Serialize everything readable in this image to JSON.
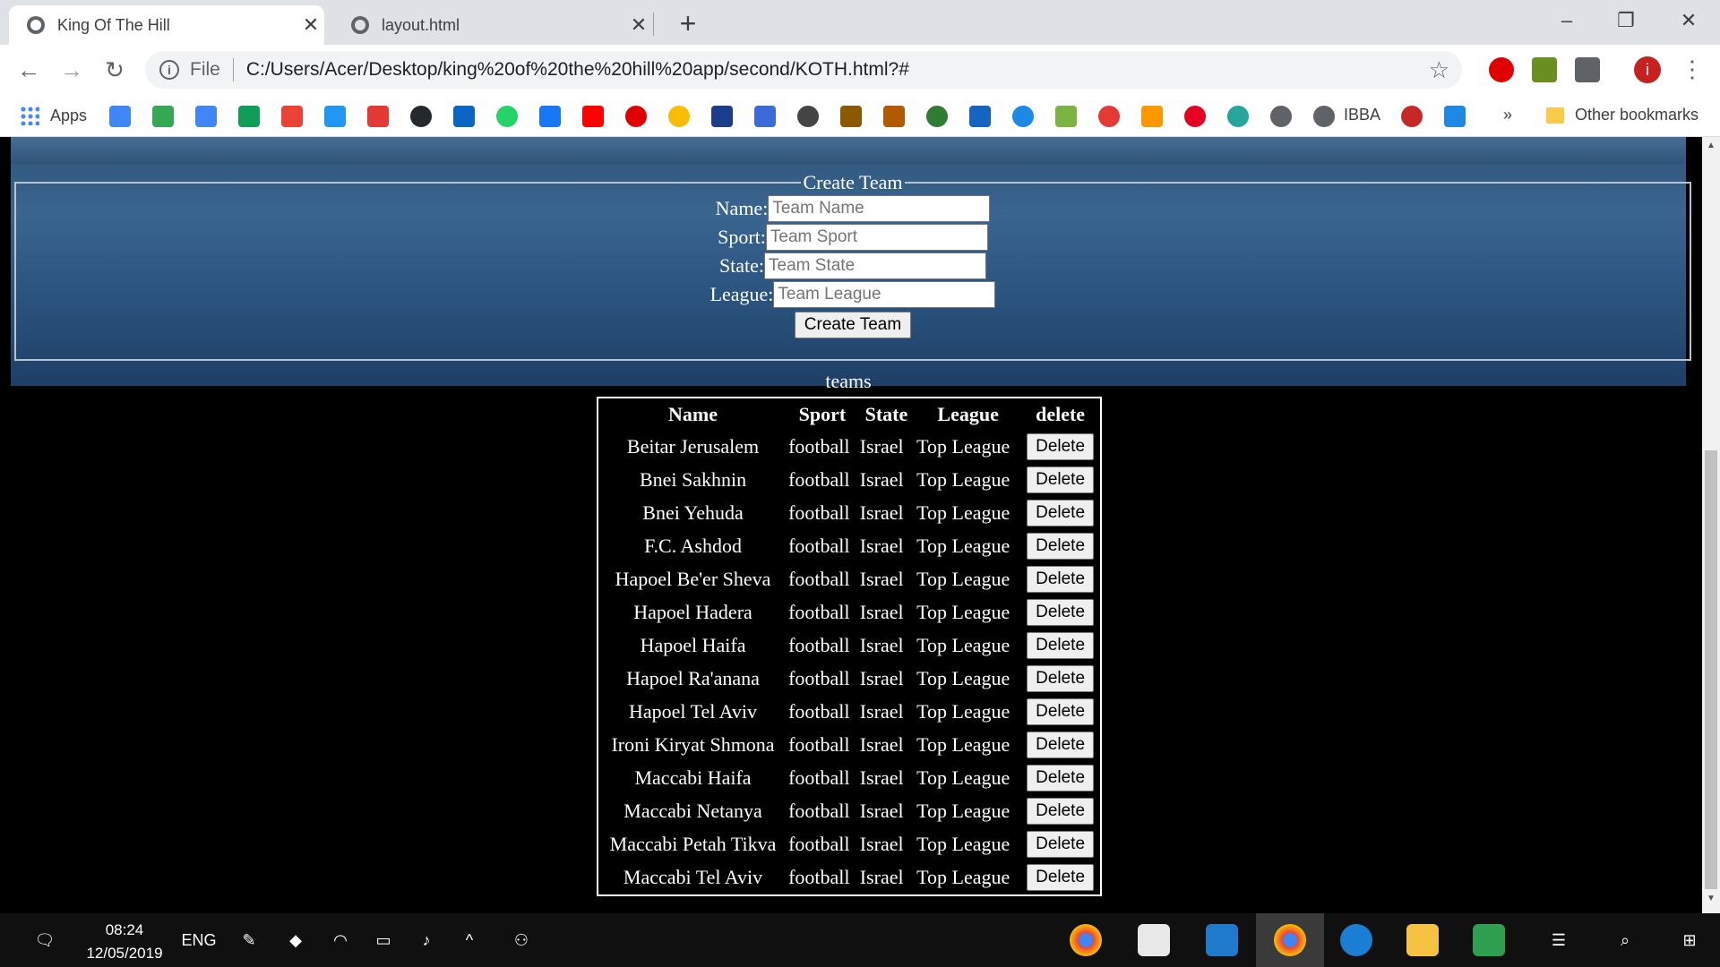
{
  "browser": {
    "tabs": [
      {
        "title": "King Of The Hill",
        "active": true
      },
      {
        "title": "layout.html",
        "active": false
      }
    ],
    "new_tab_symbol": "+",
    "window_controls": {
      "minimize": "–",
      "restore": "❐",
      "close": "✕"
    },
    "address": {
      "scheme_label": "File",
      "url": "C:/Users/Acer/Desktop/king%20of%20the%20hill%20app/second/KOTH.html?#"
    },
    "profile_initial": "i",
    "bookmarks": {
      "apps_label": "Apps",
      "ibba_label": "IBBA",
      "overflow": "»",
      "other_label": "Other bookmarks"
    }
  },
  "page": {
    "create_team": {
      "legend": "Create Team",
      "fields": [
        {
          "label": "Name:",
          "placeholder": "Team Name",
          "value": ""
        },
        {
          "label": "Sport:",
          "placeholder": "Team Sport",
          "value": ""
        },
        {
          "label": "State:",
          "placeholder": "Team State",
          "value": ""
        },
        {
          "label": "League:",
          "placeholder": "Team League",
          "value": ""
        }
      ],
      "submit_label": "Create Team"
    },
    "teams": {
      "caption": "teams",
      "headers": [
        "Name",
        "Sport",
        "State",
        "League",
        "delete"
      ],
      "delete_label": "Delete",
      "rows": [
        {
          "name": "Beitar Jerusalem",
          "sport": "football",
          "state": "Israel",
          "league": "Top League"
        },
        {
          "name": "Bnei Sakhnin",
          "sport": "football",
          "state": "Israel",
          "league": "Top League"
        },
        {
          "name": "Bnei Yehuda",
          "sport": "football",
          "state": "Israel",
          "league": "Top League"
        },
        {
          "name": "F.C. Ashdod",
          "sport": "football",
          "state": "Israel",
          "league": "Top League"
        },
        {
          "name": "Hapoel Be'er Sheva",
          "sport": "football",
          "state": "Israel",
          "league": "Top League"
        },
        {
          "name": "Hapoel Hadera",
          "sport": "football",
          "state": "Israel",
          "league": "Top League"
        },
        {
          "name": "Hapoel Haifa",
          "sport": "football",
          "state": "Israel",
          "league": "Top League"
        },
        {
          "name": "Hapoel Ra'anana",
          "sport": "football",
          "state": "Israel",
          "league": "Top League"
        },
        {
          "name": "Hapoel Tel Aviv",
          "sport": "football",
          "state": "Israel",
          "league": "Top League"
        },
        {
          "name": "Ironi Kiryat Shmona",
          "sport": "football",
          "state": "Israel",
          "league": "Top League"
        },
        {
          "name": "Maccabi Haifa",
          "sport": "football",
          "state": "Israel",
          "league": "Top League"
        },
        {
          "name": "Maccabi Netanya",
          "sport": "football",
          "state": "Israel",
          "league": "Top League"
        },
        {
          "name": "Maccabi Petah Tikva",
          "sport": "football",
          "state": "Israel",
          "league": "Top League"
        },
        {
          "name": "Maccabi Tel Aviv",
          "sport": "football",
          "state": "Israel",
          "league": "Top League"
        }
      ]
    }
  },
  "taskbar": {
    "time": "08:24",
    "date": "12/05/2019",
    "language": "ENG"
  },
  "colors": {
    "hero_background": "#2c5681",
    "page_background": "#000000",
    "taskbar": "#101010"
  }
}
